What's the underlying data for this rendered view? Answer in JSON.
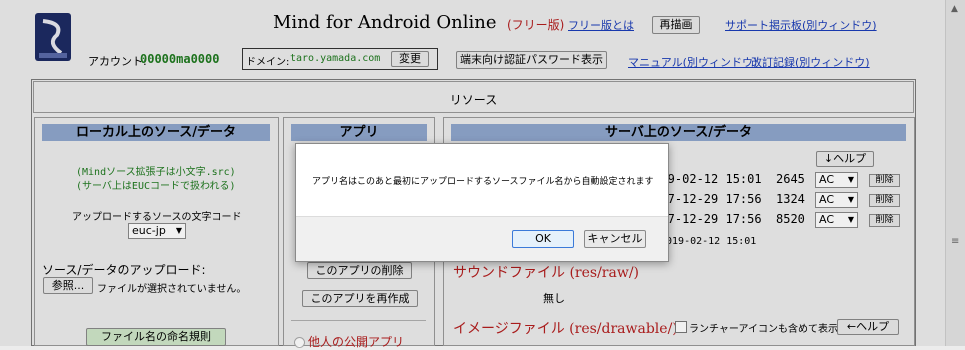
{
  "header": {
    "title": "Mind for Android Online",
    "free_edition": "(フリー版)",
    "what_is_free_link": "フリー版とは",
    "redraw_button": "再描画",
    "support_link": "サポート掲示板(別ウィンドウ)",
    "account_label": "アカウント:",
    "account_value": "00000ma0000",
    "domain_label": "ドメイン:",
    "domain_value": "taro.yamada.com",
    "change_button": "変更",
    "device_password_button": "端末向け認証パスワード表示",
    "manual_link": "マニュアル(別ウィンドウ)",
    "changelog_link": "改訂記録(別ウィンドウ)"
  },
  "resources": {
    "title": "リソース"
  },
  "local": {
    "title": "ローカル上のソース/データ",
    "note1": "(Mindソース拡張子は小文字.src)",
    "note2": "(サーバ上はEUCコードで扱われる)",
    "charset_label": "アップロードするソースの文字コード",
    "charset_value": "euc-jp",
    "upload_label": "ソース/データのアップロード:",
    "browse_button": "参照...",
    "no_file_text": "ファイルが選択されていません。",
    "naming_rules_button": "ファイル名の命名規則"
  },
  "app": {
    "title": "アプリ",
    "delete_button": "このアプリの削除",
    "recreate_button": "このアプリを再作成",
    "public_apps_label": "他人の公開アプリ"
  },
  "server": {
    "title": "サーバ上のソース/データ",
    "help_button": "↓ヘルプ",
    "rows": [
      {
        "date": "2019-02-12 15:01",
        "size": "2645",
        "code": "AC",
        "delete": "削除"
      },
      {
        "date": "2017-12-29 17:56",
        "size": "1324",
        "code": "AC",
        "delete": "削除"
      },
      {
        "date": "2017-12-29 17:56",
        "size": "8520",
        "code": "AC",
        "delete": "削除"
      }
    ],
    "last_date": "2019-02-12 15:01",
    "sound_title": "サウンドファイル (res/raw/)",
    "sound_none": "無し",
    "image_title": "イメージファイル (res/drawable/)",
    "launcher_checkbox_label": "ランチャーアイコンも含めて表示",
    "image_help_button": "←ヘルプ"
  },
  "dialog": {
    "message": "アプリ名はこのあと最初にアップロードするソースファイル名から自動設定されます",
    "ok_button": "OK",
    "cancel_button": "キャンセル"
  },
  "colors": {
    "section_bar": "#8fa6cc",
    "red_heading": "#b41e1e",
    "green_text": "#1f7a1f",
    "link": "#1a3cb8"
  }
}
